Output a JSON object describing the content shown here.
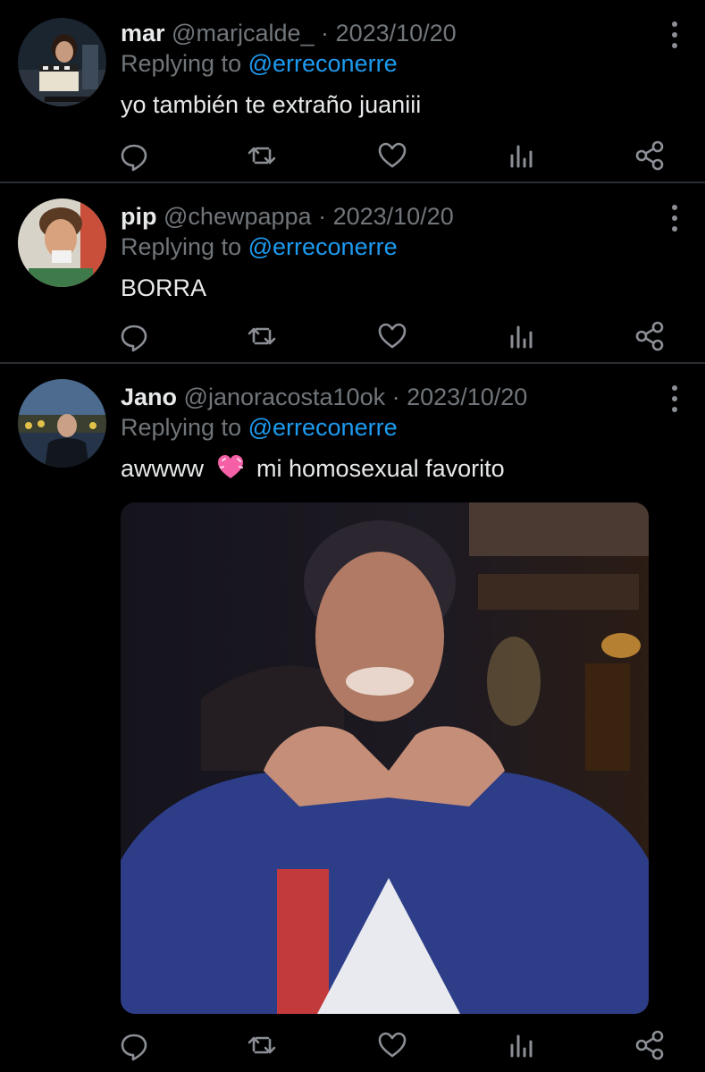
{
  "colors": {
    "background": "#000000",
    "text_primary": "#e7e9ea",
    "text_secondary": "#71767b",
    "accent": "#1d9bf0",
    "divider": "#2a2e33"
  },
  "tweets": [
    {
      "name": "mar",
      "handle": "@marjcalde_",
      "separator": "·",
      "date": "2023/10/20",
      "reply_prefix": "Replying to",
      "reply_handle": "@erreconerre",
      "text": "yo también te extraño juaniii"
    },
    {
      "name": "pip",
      "handle": "@chewpappa",
      "separator": "·",
      "date": "2023/10/20",
      "reply_prefix": "Replying to",
      "reply_handle": "@erreconerre",
      "text": "BORRA"
    },
    {
      "name": "Jano",
      "handle": "@janoracosta10ok",
      "separator": "·",
      "date": "2023/10/20",
      "reply_prefix": "Replying to",
      "reply_handle": "@erreconerre",
      "text_before_emoji": "awwww",
      "emoji": "pink-heart-emoji",
      "text_after_emoji": "mi homosexual favorito"
    }
  ],
  "icons": {
    "reply": "comment-icon",
    "retweet": "retweet-icon",
    "like": "heart-icon",
    "views": "views-icon",
    "share": "share-icon",
    "more": "more-vertical-icon"
  }
}
